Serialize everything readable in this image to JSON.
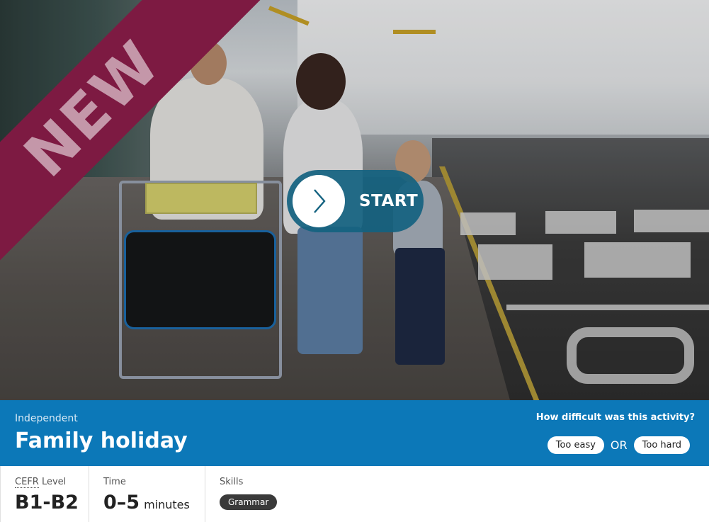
{
  "hero": {
    "badge": "NEW",
    "start_label": "START"
  },
  "activity": {
    "type": "Independent",
    "title": "Family holiday",
    "feedback_question": "How difficult was this activity?",
    "too_easy_label": "Too easy",
    "or_label": "OR",
    "too_hard_label": "Too hard"
  },
  "info": {
    "cefr_abbr": "CEFR",
    "cefr_label_suffix": " Level",
    "cefr_value": "B1-B2",
    "time_label": "Time",
    "time_value": "0–5",
    "time_unit": "minutes",
    "skills_label": "Skills",
    "skills": [
      "Grammar"
    ]
  },
  "colors": {
    "ribbon": "#7d1a42",
    "start_button": "#136280",
    "info_bar": "#0c78b8",
    "skill_chip": "#3a3a3a"
  },
  "icons": {
    "start": "chevron-right-icon"
  }
}
